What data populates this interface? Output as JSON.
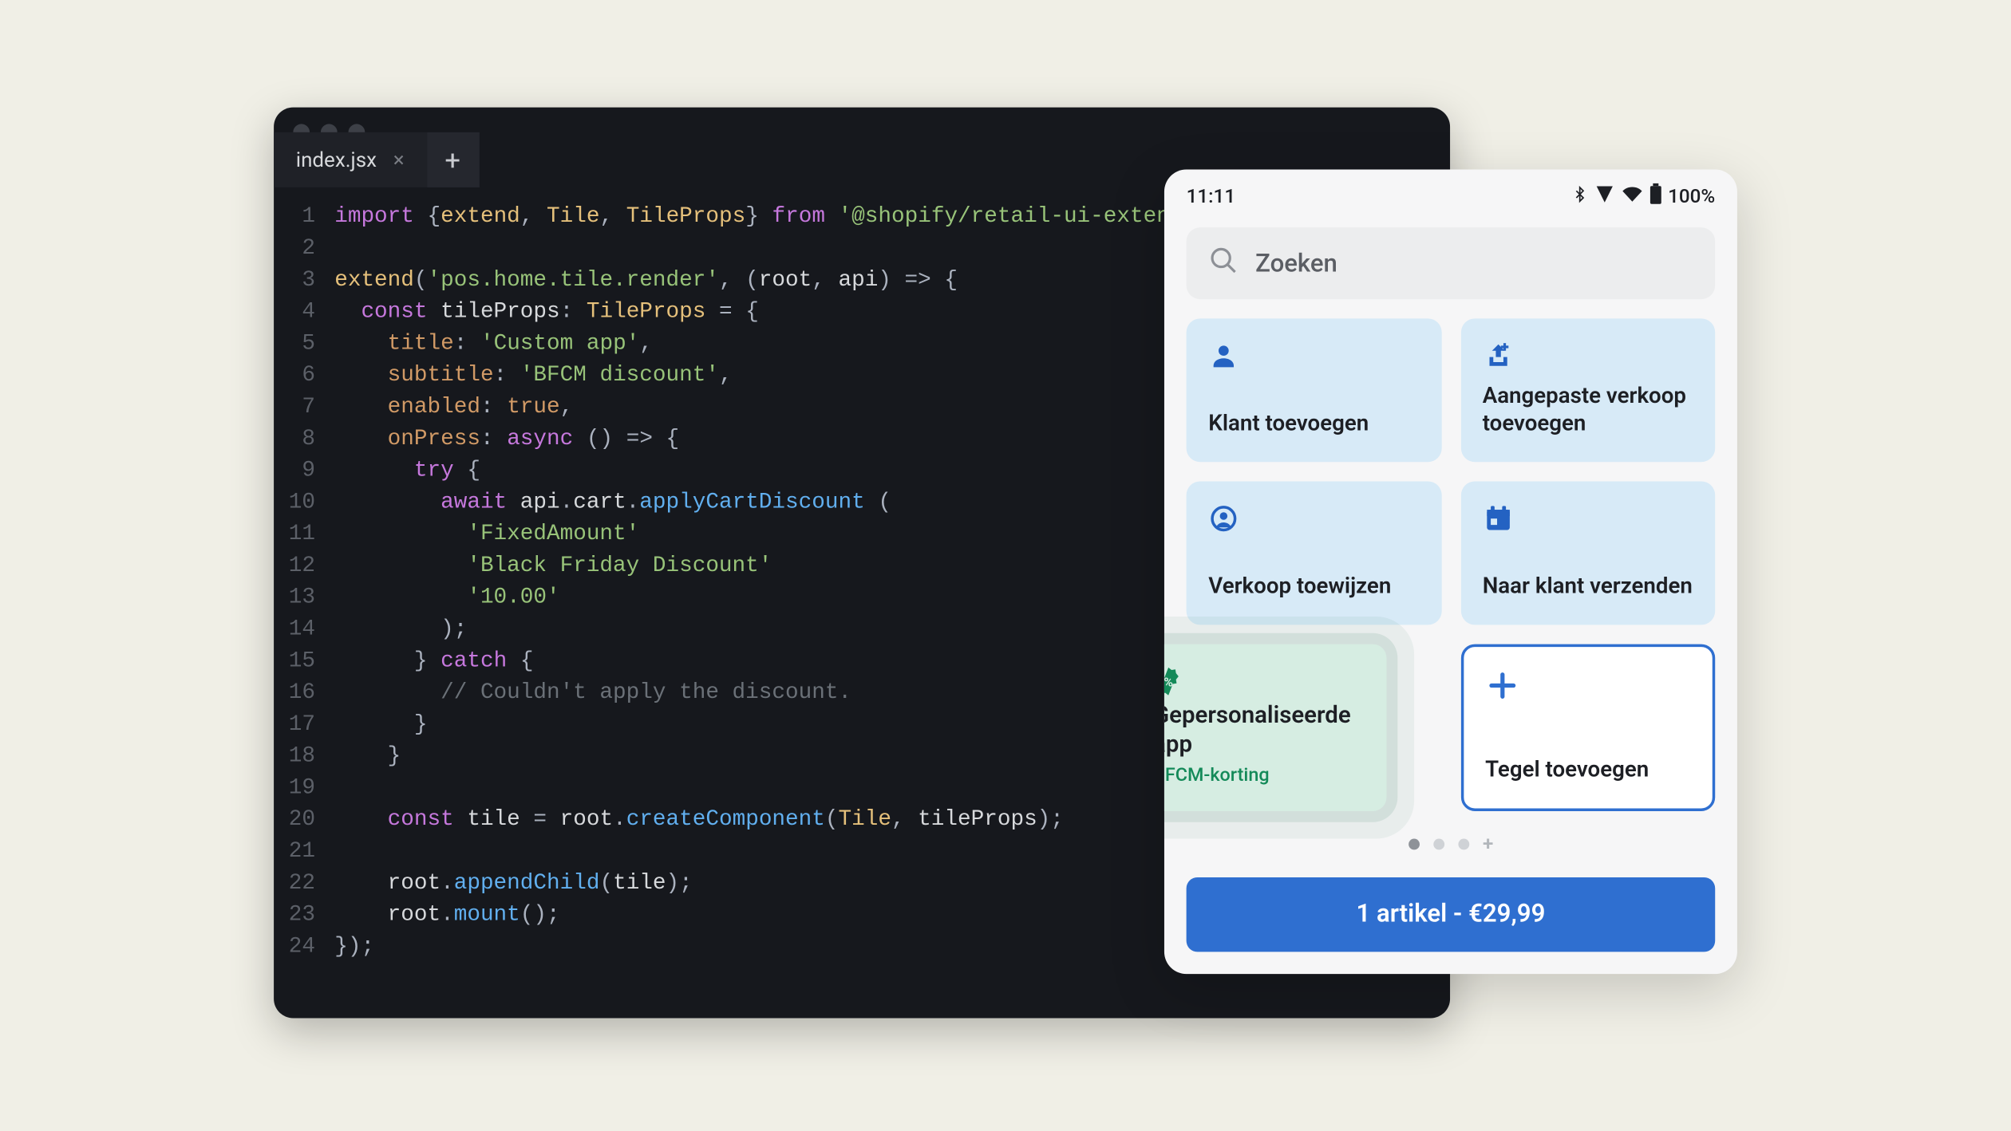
{
  "editor": {
    "tab_name": "index.jsx",
    "lines": [
      {
        "n": 1,
        "html": "<span class='tk-imp'>import</span> <span class='tk-punc'>{</span><span class='tk-fn'>extend</span><span class='tk-punc'>,</span> <span class='tk-fn'>Tile</span><span class='tk-punc'>,</span> <span class='tk-fn'>TileProps</span><span class='tk-punc'>}</span> <span class='tk-imp'>from</span> <span class='tk-str'>'@shopify/retail-ui-extensions'</span><span class='tk-punc'>;</span>"
      },
      {
        "n": 2,
        "html": ""
      },
      {
        "n": 3,
        "html": "<span class='tk-fn'>extend</span><span class='tk-punc'>(</span><span class='tk-str'>'pos.home.tile.render'</span><span class='tk-punc'>, (</span>root<span class='tk-punc'>,</span> api<span class='tk-punc'>) =&gt; {</span>"
      },
      {
        "n": 4,
        "html": "  <span class='tk-kw'>const</span> tileProps<span class='tk-punc'>:</span> <span class='tk-fn'>TileProps</span> <span class='tk-punc'>= {</span>"
      },
      {
        "n": 5,
        "html": "    <span class='tk-key'>title</span><span class='tk-punc'>:</span> <span class='tk-str'>'Custom app'</span><span class='tk-punc'>,</span>"
      },
      {
        "n": 6,
        "html": "    <span class='tk-key'>subtitle</span><span class='tk-punc'>:</span> <span class='tk-str'>'BFCM discount'</span><span class='tk-punc'>,</span>"
      },
      {
        "n": 7,
        "html": "    <span class='tk-key'>enabled</span><span class='tk-punc'>:</span> <span class='tk-bool'>true</span><span class='tk-punc'>,</span>"
      },
      {
        "n": 8,
        "html": "    <span class='tk-key'>onPress</span><span class='tk-punc'>:</span> <span class='tk-kw'>async</span> <span class='tk-punc'>() =&gt; {</span>"
      },
      {
        "n": 9,
        "html": "      <span class='tk-kw'>try</span> <span class='tk-punc'>{</span>"
      },
      {
        "n": 10,
        "html": "        <span class='tk-kw'>await</span> api<span class='tk-punc'>.</span>cart<span class='tk-punc'>.</span><span class='tk-call'>applyCartDiscount</span> <span class='tk-punc'>(</span>"
      },
      {
        "n": 11,
        "html": "          <span class='tk-str'>'FixedAmount'</span>"
      },
      {
        "n": 12,
        "html": "          <span class='tk-str'>'Black Friday Discount'</span>"
      },
      {
        "n": 13,
        "html": "          <span class='tk-str'>'10.00'</span>"
      },
      {
        "n": 14,
        "html": "        <span class='tk-punc'>);</span>"
      },
      {
        "n": 15,
        "html": "      <span class='tk-punc'>}</span> <span class='tk-kw'>catch</span> <span class='tk-punc'>{</span>"
      },
      {
        "n": 16,
        "html": "        <span class='tk-cmt'>// Couldn't apply the discount.</span>"
      },
      {
        "n": 17,
        "html": "      <span class='tk-punc'>}</span>"
      },
      {
        "n": 18,
        "html": "    <span class='tk-punc'>}</span>"
      },
      {
        "n": 19,
        "html": ""
      },
      {
        "n": 20,
        "html": "    <span class='tk-kw'>const</span> tile <span class='tk-punc'>=</span> root<span class='tk-punc'>.</span><span class='tk-call'>createComponent</span><span class='tk-punc'>(</span><span class='tk-fn'>Tile</span><span class='tk-punc'>,</span> tileProps<span class='tk-punc'>);</span>"
      },
      {
        "n": 21,
        "html": ""
      },
      {
        "n": 22,
        "html": "    root<span class='tk-punc'>.</span><span class='tk-call'>appendChild</span><span class='tk-punc'>(</span>tile<span class='tk-punc'>);</span>"
      },
      {
        "n": 23,
        "html": "    root<span class='tk-punc'>.</span><span class='tk-call'>mount</span><span class='tk-punc'>();</span>"
      },
      {
        "n": 24,
        "html": "<span class='tk-punc'>});</span>"
      }
    ]
  },
  "phone": {
    "status": {
      "time": "11:11",
      "battery": "100%"
    },
    "search_placeholder": "Zoeken",
    "tiles": {
      "add_customer": "Klant toevoegen",
      "custom_sale": "Aangepaste verkoop toevoegen",
      "assign_sale": "Verkoop toewijzen",
      "ship_to": "Naar klant verzenden",
      "custom_app": {
        "title": "Gepersonaliseerde app",
        "subtitle": "BFCM-korting"
      },
      "add_tile": "Tegel toevoegen"
    },
    "checkout_label": "1 artikel - €29,99"
  }
}
